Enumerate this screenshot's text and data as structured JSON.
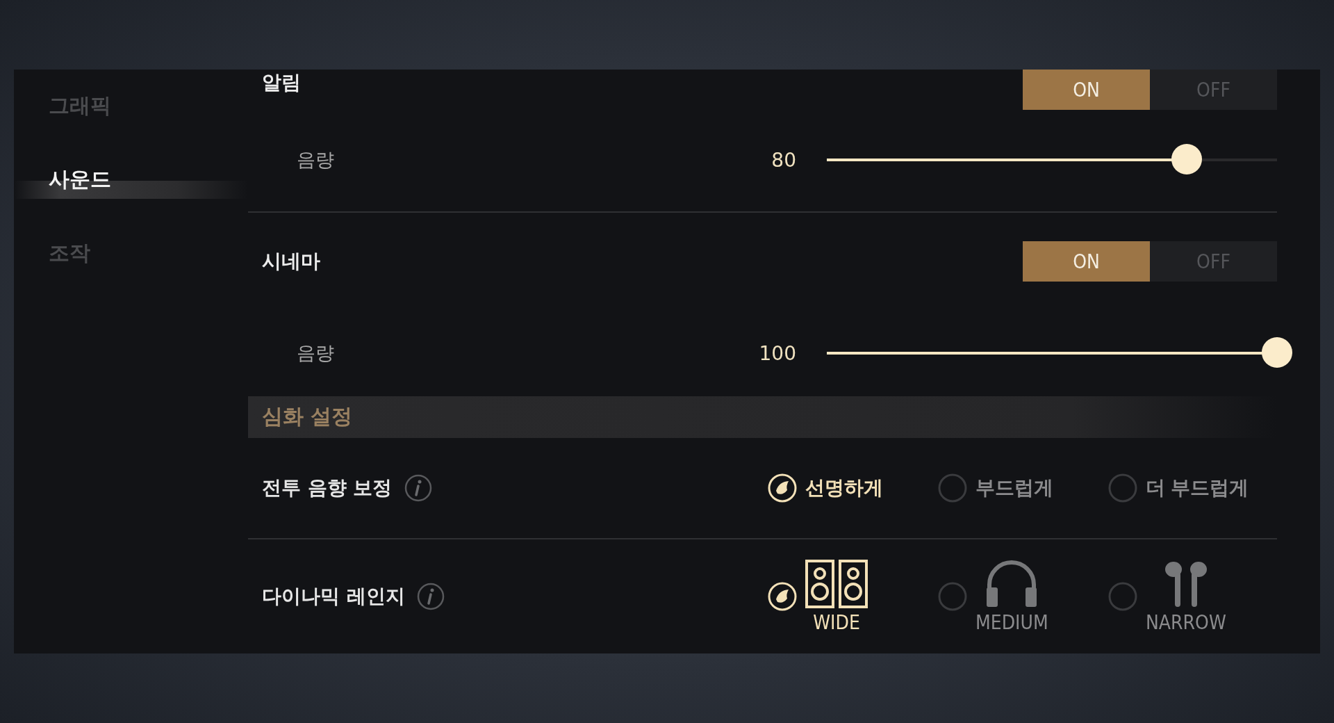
{
  "sidebar": {
    "items": [
      {
        "label": "그래픽",
        "selected": false
      },
      {
        "label": "사운드",
        "selected": true
      },
      {
        "label": "조작",
        "selected": false
      }
    ]
  },
  "groups": [
    {
      "label": "알림",
      "options": [
        {
          "label": "ON",
          "selected": true
        },
        {
          "label": "OFF",
          "selected": false
        }
      ],
      "volume": {
        "label": "음량",
        "reading": "80",
        "level": 0.8
      }
    },
    {
      "label": "시네마",
      "options": [
        {
          "label": "ON",
          "selected": true
        },
        {
          "label": "OFF",
          "selected": false
        }
      ],
      "volume": {
        "label": "음량",
        "reading": "100",
        "level": 1.0
      }
    }
  ],
  "section": {
    "title": "심화 설정"
  },
  "advanced": [
    {
      "kind": "text",
      "label": "전투 음향 보정",
      "choices": [
        {
          "label": "선명하게",
          "selected": true
        },
        {
          "label": "부드럽게",
          "selected": false
        },
        {
          "label": "더 부드럽게",
          "selected": false
        }
      ]
    },
    {
      "kind": "icon",
      "label": "다이나믹 레인지",
      "choices": [
        {
          "label": "WIDE",
          "selected": true
        },
        {
          "label": "MEDIUM",
          "selected": false
        },
        {
          "label": "NARROW",
          "selected": false
        }
      ]
    }
  ]
}
